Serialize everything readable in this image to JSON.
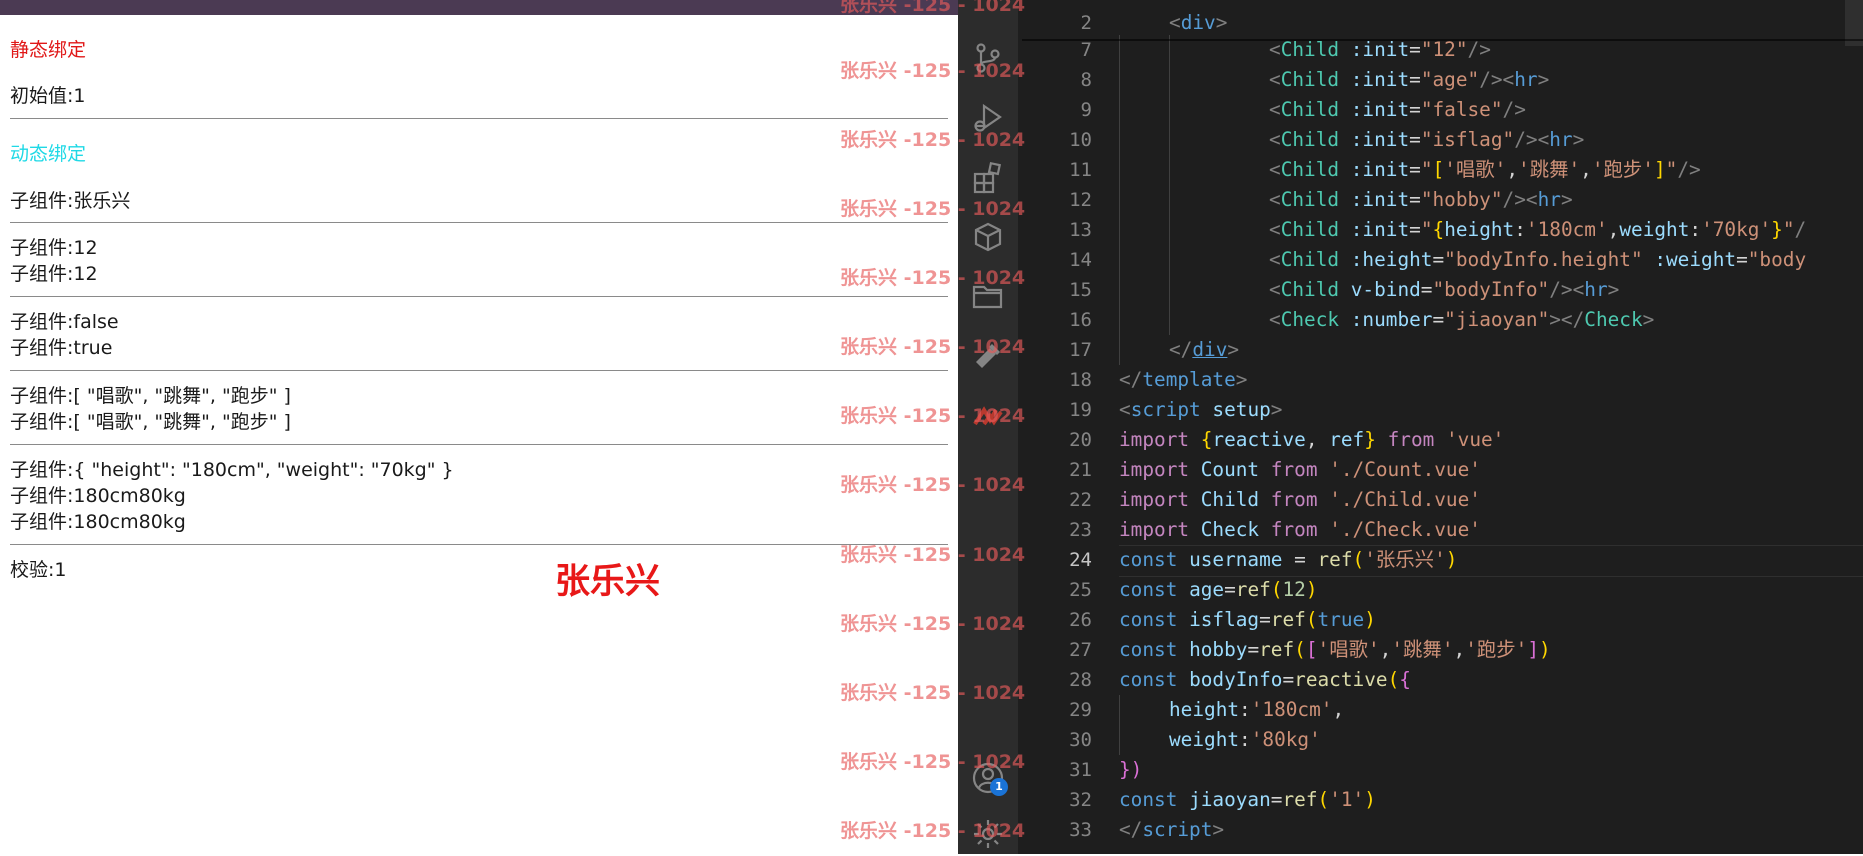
{
  "preview": {
    "static_heading": "静态绑定",
    "initial_value": "初始值:1",
    "dynamic_heading": "动态绑定",
    "child_name": "子组件:张乐兴",
    "child_12_a": "子组件:12",
    "child_12_b": "子组件:12",
    "child_false": "子组件:false",
    "child_true": "子组件:true",
    "child_hobby_a": "子组件:[ \"唱歌\", \"跳舞\", \"跑步\" ]",
    "child_hobby_b": "子组件:[ \"唱歌\", \"跳舞\", \"跑步\" ]",
    "child_obj": "子组件:{ \"height\": \"180cm\", \"weight\": \"70kg\" }",
    "child_hw_a": "子组件:180cm80kg",
    "child_hw_b": "子组件:180cm80kg",
    "check_line": "校验:1",
    "brand_name": "张乐兴",
    "watermark": "张乐兴 -125 - 1024",
    "colors": {
      "static_heading": "#e01818",
      "dynamic_heading": "#1fd9e6",
      "brand": "#e81818"
    }
  },
  "activity_bar": {
    "icons": [
      "source-control-icon",
      "run-debug-icon",
      "extensions-icon",
      "package-icon",
      "folder-icon",
      "tools-icon",
      "vue-logo-icon",
      "account-icon",
      "settings-icon"
    ],
    "account_badge": "1"
  },
  "editor": {
    "line_numbers": [
      "2",
      "7",
      "8",
      "9",
      "10",
      "11",
      "12",
      "13",
      "14",
      "15",
      "16",
      "17",
      "18",
      "19",
      "20",
      "21",
      "22",
      "23",
      "24",
      "25",
      "26",
      "27",
      "28",
      "29",
      "30",
      "31",
      "32",
      "33"
    ],
    "active_line": "24",
    "code": {
      "l2": {
        "t": "div"
      },
      "l7": {
        "t": "Child",
        "a": ":init",
        "v": "\"12\""
      },
      "l8": {
        "t": "Child",
        "a": ":init",
        "v": "\"age\"",
        "hr": "hr"
      },
      "l9": {
        "t": "Child",
        "a": ":init",
        "v": "\"false\""
      },
      "l10": {
        "t": "Child",
        "a": ":init",
        "v": "\"isflag\"",
        "hr": "hr"
      },
      "l11": {
        "t": "Child",
        "a": ":init",
        "q": "\"",
        "s1": "'唱歌'",
        "s2": "'跳舞'",
        "s3": "'跑步'"
      },
      "l12": {
        "t": "Child",
        "a": ":init",
        "v": "\"hobby\"",
        "hr": "hr"
      },
      "l13": {
        "t": "Child",
        "a": ":init",
        "q": "\"",
        "k1": "height",
        "s1": "'180cm'",
        "k2": "weight",
        "s2": "'70kg'"
      },
      "l14": {
        "t": "Child",
        "a1": ":height",
        "v1": "\"bodyInfo.height\"",
        "a2": ":weight",
        "v2": "\"body"
      },
      "l15": {
        "t": "Child",
        "a": "v-bind",
        "v": "\"bodyInfo\"",
        "hr": "hr"
      },
      "l16": {
        "t": "Check",
        "a": ":number",
        "v": "\"jiaoyan\"",
        "t2": "Check"
      },
      "l17": {
        "t": "div"
      },
      "l18": {
        "t": "template"
      },
      "l19": {
        "t": "script",
        "a": "setup"
      },
      "l20": {
        "kw": "import",
        "i1": "reactive",
        "i2": "ref",
        "from": "from",
        "src": "'vue'"
      },
      "l21": {
        "kw": "import",
        "i": "Count",
        "from": "from",
        "src": "'./Count.vue'"
      },
      "l22": {
        "kw": "import",
        "i": "Child",
        "from": "from",
        "src": "'./Child.vue'"
      },
      "l23": {
        "kw": "import",
        "i": "Check",
        "from": "from",
        "src": "'./Check.vue'"
      },
      "l24": {
        "kw": "const",
        "n": "username",
        "op": " = ",
        "f": "ref",
        "s": "'张乐兴'"
      },
      "l25": {
        "kw": "const",
        "n": "age",
        "f": "ref",
        "num": "12"
      },
      "l26": {
        "kw": "const",
        "n": "isflag",
        "f": "ref",
        "b": "true"
      },
      "l27": {
        "kw": "const",
        "n": "hobby",
        "f": "ref",
        "s1": "'唱歌'",
        "s2": "'跳舞'",
        "s3": "'跑步'"
      },
      "l28": {
        "kw": "const",
        "n": "bodyInfo",
        "f": "reactive"
      },
      "l29": {
        "k": "height",
        "s": "'180cm'"
      },
      "l30": {
        "k": "weight",
        "s": "'80kg'"
      },
      "l31": {
        "x": "})"
      },
      "l32": {
        "kw": "const",
        "n": "jiaoyan",
        "f": "ref",
        "s": "'1'"
      },
      "l33": {
        "t": "script"
      }
    }
  }
}
